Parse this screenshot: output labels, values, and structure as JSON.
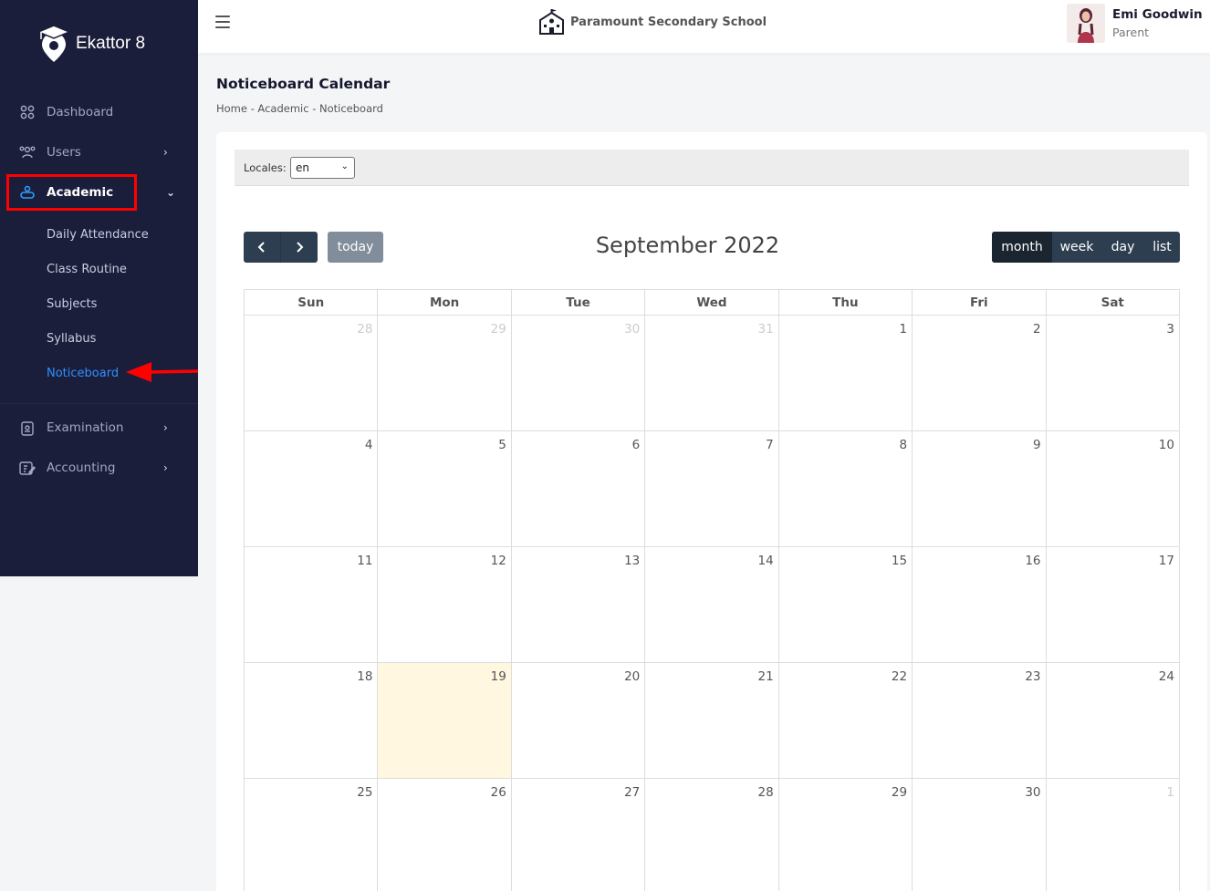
{
  "brand": {
    "name": "Ekattor 8"
  },
  "sidebar": {
    "items": [
      {
        "label": "Dashboard",
        "icon": "dashboard-grid-icon"
      },
      {
        "label": "Users",
        "icon": "users-icon"
      },
      {
        "label": "Academic",
        "icon": "academic-icon"
      },
      {
        "label": "Examination",
        "icon": "examination-icon"
      },
      {
        "label": "Accounting",
        "icon": "accounting-icon"
      }
    ],
    "sub_items": [
      {
        "label": "Daily Attendance"
      },
      {
        "label": "Class Routine"
      },
      {
        "label": "Subjects"
      },
      {
        "label": "Syllabus"
      },
      {
        "label": "Noticeboard"
      }
    ]
  },
  "topbar": {
    "school_name": "Paramount Secondary School",
    "user_name": "Emi Goodwin",
    "user_role": "Parent"
  },
  "page": {
    "title": "Noticeboard Calendar",
    "breadcrumb": "Home - Academic - Noticeboard"
  },
  "locales": {
    "label": "Locales:",
    "value": "en"
  },
  "calendar": {
    "title": "September 2022",
    "today_label": "today",
    "views": [
      "month",
      "week",
      "day",
      "list"
    ],
    "active_view": "month",
    "weekdays": [
      "Sun",
      "Mon",
      "Tue",
      "Wed",
      "Thu",
      "Fri",
      "Sat"
    ],
    "weeks": [
      [
        "28",
        "29",
        "30",
        "31",
        "1",
        "2",
        "3"
      ],
      [
        "4",
        "5",
        "6",
        "7",
        "8",
        "9",
        "10"
      ],
      [
        "11",
        "12",
        "13",
        "14",
        "15",
        "16",
        "17"
      ],
      [
        "18",
        "19",
        "20",
        "21",
        "22",
        "23",
        "24"
      ],
      [
        "25",
        "26",
        "27",
        "28",
        "29",
        "30",
        "1"
      ]
    ],
    "today_date": "19",
    "colors": {
      "today_bg": "#fff7df",
      "button": "#2c3e50",
      "active_button": "#1a252f"
    }
  }
}
